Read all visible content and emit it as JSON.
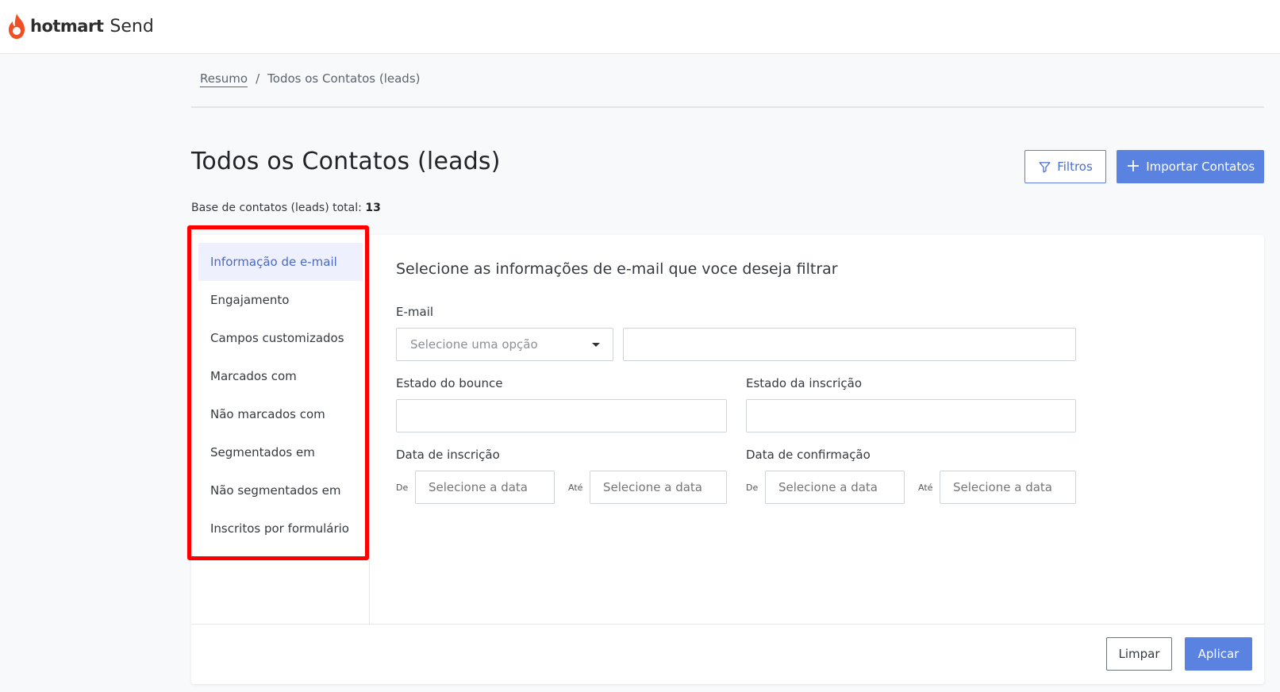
{
  "app": {
    "brand": "hotmart",
    "product": "Send",
    "accent": "#5a82e0",
    "logo_color": "#f04e23"
  },
  "breadcrumb": {
    "home": "Resumo",
    "separator": "/",
    "current": "Todos os Contatos (leads)"
  },
  "page": {
    "title": "Todos os Contatos (leads)",
    "total_label": "Base de contatos (leads) total:",
    "total_value": "13"
  },
  "toolbar": {
    "filters_label": "Filtros",
    "import_label": "Importar Contatos"
  },
  "sidebar": {
    "items": [
      {
        "label": "Informação de e-mail",
        "active": true
      },
      {
        "label": "Engajamento",
        "active": false
      },
      {
        "label": "Campos customizados",
        "active": false
      },
      {
        "label": "Marcados com",
        "active": false
      },
      {
        "label": "Não marcados com",
        "active": false
      },
      {
        "label": "Segmentados em",
        "active": false
      },
      {
        "label": "Não segmentados em",
        "active": false
      },
      {
        "label": "Inscritos por formulário",
        "active": false
      }
    ]
  },
  "form": {
    "title": "Selecione as informações de e-mail que voce deseja filtrar",
    "email": {
      "label": "E-mail",
      "select_placeholder": "Selecione uma opção",
      "value": ""
    },
    "bounce": {
      "label": "Estado do bounce",
      "value": ""
    },
    "subscription": {
      "label": "Estado da inscrição",
      "value": ""
    },
    "signup_date": {
      "label": "Data de inscrição",
      "from": "De",
      "to": "Até",
      "placeholder": "Selecione a data"
    },
    "confirm_date": {
      "label": "Data de confirmação",
      "from": "De",
      "to": "Até",
      "placeholder": "Selecione a data"
    }
  },
  "footer": {
    "clear_label": "Limpar",
    "apply_label": "Aplicar"
  }
}
